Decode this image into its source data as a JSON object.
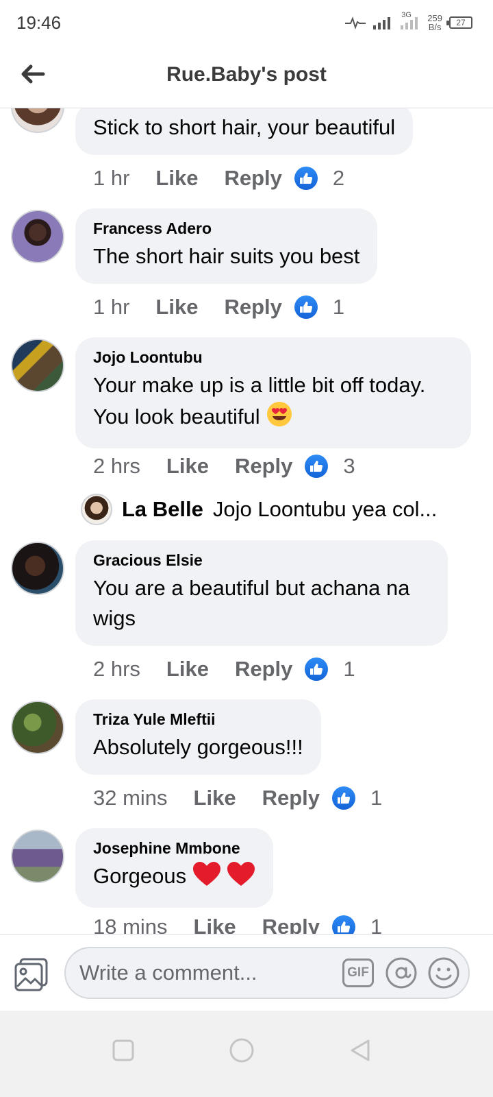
{
  "status_bar": {
    "time": "19:46",
    "network": "3G",
    "speed_value": "259",
    "speed_unit": "B/s",
    "battery": "27"
  },
  "header": {
    "title": "Rue.Baby's post",
    "back_icon": "arrow-left-icon"
  },
  "comments": [
    {
      "author": "",
      "text": "Stick to short hair, your beautiful",
      "time": "1 hr",
      "like_label": "Like",
      "reply_label": "Reply",
      "likes": "2"
    },
    {
      "author": "Francess Adero",
      "text": "The short hair suits you best",
      "time": "1 hr",
      "like_label": "Like",
      "reply_label": "Reply",
      "likes": "1"
    },
    {
      "author": "Jojo Loontubu",
      "text_line1": "Your make up is a little bit off today.",
      "text_line2": "You look beautiful",
      "time": "2 hrs",
      "like_label": "Like",
      "reply_label": "Reply",
      "likes": "3"
    },
    {
      "author": "Gracious Elsie",
      "text_line1": "You are a beautiful but achana na",
      "text_line2": "wigs",
      "time": "2 hrs",
      "like_label": "Like",
      "reply_label": "Reply",
      "likes": "1"
    },
    {
      "author": "Triza Yule Mleftii",
      "text": "Absolutely gorgeous!!!",
      "time": "32 mins",
      "like_label": "Like",
      "reply_label": "Reply",
      "likes": "1"
    },
    {
      "author": "Josephine Mmbone",
      "text": "Gorgeous",
      "time": "18 mins",
      "like_label": "Like",
      "reply_label": "Reply",
      "likes": "1"
    }
  ],
  "reply_preview": {
    "author": "La Belle",
    "text": "Jojo Loontubu yea col..."
  },
  "composer": {
    "placeholder": "Write a comment...",
    "gif_label": "GIF"
  },
  "colors": {
    "like_blue": "#1877f2",
    "bubble_bg": "#f0f2f5",
    "meta_gray": "#65676b"
  }
}
